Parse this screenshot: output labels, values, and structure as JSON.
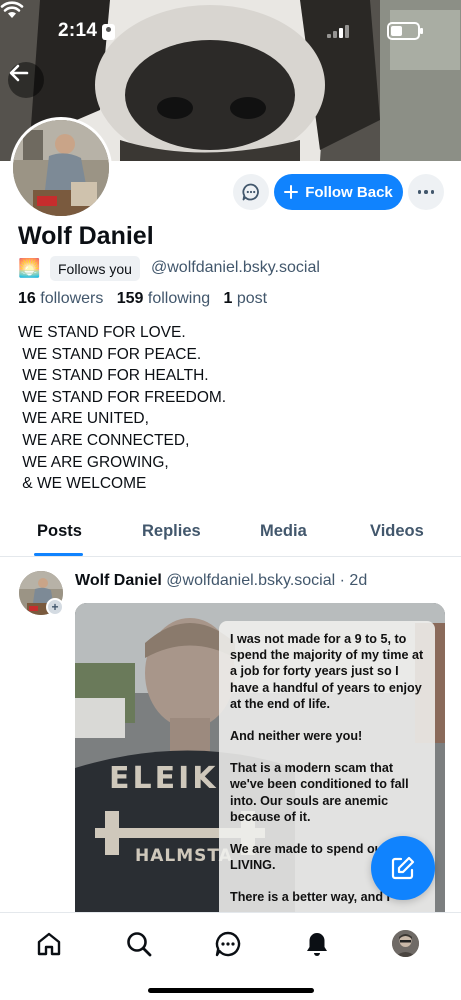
{
  "status_bar": {
    "time": "2:14"
  },
  "profile": {
    "display_name": "Wolf Daniel",
    "emoji": "🌅",
    "follows_you_label": "Follows you",
    "handle": "@wolfdaniel.bsky.social",
    "followers_count": "16",
    "followers_label": "followers",
    "following_count": "159",
    "following_label": "following",
    "posts_count": "1",
    "posts_label": "post",
    "bio": "WE STAND FOR LOVE.\n WE STAND FOR PEACE.\n WE STAND FOR HEALTH.\n WE STAND FOR FREEDOM.\n WE ARE UNITED,\n WE ARE CONNECTED,\n WE ARE GROWING,\n & WE WELCOME"
  },
  "actions": {
    "follow_back_label": "Follow Back"
  },
  "tabs": [
    {
      "label": "Posts",
      "active": true
    },
    {
      "label": "Replies",
      "active": false
    },
    {
      "label": "Media",
      "active": false
    },
    {
      "label": "Videos",
      "active": false
    }
  ],
  "post": {
    "author": "Wolf Daniel",
    "handle": "@wolfdaniel.bsky.social",
    "separator": "·",
    "age": "2d",
    "image_text": [
      "I was not made for a 9 to 5, to spend the majority of my time at a job for forty years just so I have a handful of years to enjoy at the end of life.",
      "And neither were you!",
      "That is a modern scam that we've been conditioned to fall into. Our souls are anemic because of it.",
      "We are made to spend our LIVING.",
      "There is a better way, and I"
    ],
    "shirt_text_1": "ELEIK",
    "shirt_text_2": "HALMSTA"
  },
  "nav": {
    "items": [
      "home-icon",
      "search-icon",
      "chat-icon",
      "notifications-icon",
      "profile-avatar"
    ]
  },
  "colors": {
    "accent": "#1083fe",
    "muted": "#42576c",
    "chip_bg": "#eef1f4"
  }
}
